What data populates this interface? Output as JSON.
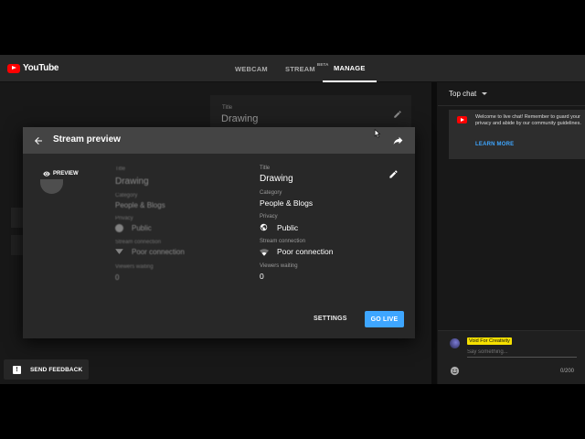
{
  "brand": {
    "name": "YouTube",
    "red": "#ff0000"
  },
  "nav": {
    "tabs": [
      {
        "label": "WEBCAM"
      },
      {
        "label": "STREAM",
        "badge": "BETA"
      },
      {
        "label": "MANAGE",
        "active": true
      }
    ]
  },
  "background": {
    "title_label": "Title",
    "title": "Drawing"
  },
  "modal": {
    "title": "Stream preview",
    "preview_label": "PREVIEW",
    "ghost": {
      "title_label": "Title",
      "title": "Drawing",
      "category_label": "Category",
      "category": "People & Blogs",
      "privacy_label": "Privacy",
      "privacy": "Public",
      "connection_label": "Stream connection",
      "connection": "Poor connection",
      "viewers_label": "Viewers waiting",
      "viewers": "0"
    },
    "fields": {
      "title_label": "Title",
      "title": "Drawing",
      "category_label": "Category",
      "category": "People & Blogs",
      "privacy_label": "Privacy",
      "privacy": "Public",
      "connection_label": "Stream connection",
      "connection": "Poor connection",
      "viewers_label": "Viewers waiting",
      "viewers": "0"
    },
    "settings_label": "SETTINGS",
    "go_live_label": "GO LIVE",
    "accent": "#3ea6ff"
  },
  "feedback": {
    "label": "SEND FEEDBACK"
  },
  "chat": {
    "title": "Top chat",
    "welcome": "Welcome to live chat! Remember to guard your privacy and abide by our community guidelines.",
    "learn_more": "LEARN MORE",
    "user_name": "Void For Creativity",
    "input_placeholder": "Say something...",
    "char_count": "0/200"
  }
}
